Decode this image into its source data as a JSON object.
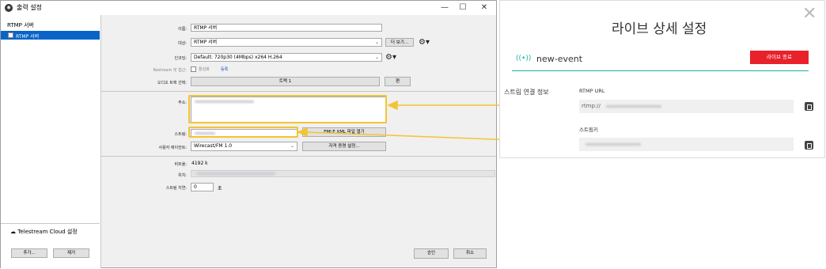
{
  "window": {
    "title": "출력 설정",
    "controls": {
      "minimize": "—",
      "maximize": "☐",
      "close": "✕"
    }
  },
  "sidebar": {
    "header": "RTMP 서버",
    "selected_item": "RTMP 서버",
    "cloud_label": "Telestream Cloud 설정",
    "add_button": "추가...",
    "remove_button": "제거"
  },
  "form": {
    "name_label": "이름:",
    "name_value": "RTMP 서버",
    "target_label": "대상:",
    "target_value": "RTMP 서버",
    "view_button": "더 보기...",
    "encoding_label": "인코딩:",
    "encoding_value": "Default: 720p30 (4Mbps) x264 H.264",
    "restream_label": "Restream 및 접근:",
    "restream_enable": "활성화",
    "restream_link": "등록",
    "audio_label": "오디오 트랙 선택:",
    "audio_value": "트랙 1",
    "edit_button": "편",
    "address_label": "주소:",
    "stream_label": "스트림:",
    "fmle_button": "FMLE XML 파일 열기",
    "useragent_label": "사용자 에이전트:",
    "useragent_value": "Wirecast/FM 1.0",
    "credentials_button": "자격 증명 설정...",
    "bitrate_label": "비트율:",
    "bitrate_value": "4192 k",
    "location_label": "위치:",
    "delay_label": "스트림 지연:",
    "delay_value": "0",
    "delay_unit": "초",
    "ok_button": "승인",
    "cancel_button": "취소"
  },
  "panel": {
    "title": "라이브 상세 설정",
    "close": "✕",
    "event_name": "new-event",
    "end_button": "라이브 종료",
    "stream_info_label": "스트림 연결 정보",
    "rtmp_url_label": "RTMP URL",
    "rtmp_url_prefix": "rtmp://",
    "stream_key_label": "스트림키"
  },
  "colors": {
    "callout": "#f3c433",
    "accent_teal": "#18b3a7",
    "end_button": "#e8212b",
    "selection": "#0a64c8"
  }
}
